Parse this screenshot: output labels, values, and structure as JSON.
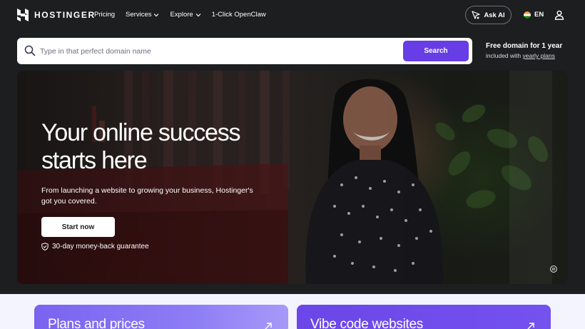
{
  "brand": {
    "name": "HOSTINGER",
    "accent": "#673de6"
  },
  "nav": {
    "items": [
      {
        "label": "Pricing",
        "dropdown": false
      },
      {
        "label": "Services",
        "dropdown": true
      },
      {
        "label": "Explore",
        "dropdown": true
      },
      {
        "label": "1-Click OpenClaw",
        "dropdown": false
      }
    ],
    "ask_ai": "Ask AI",
    "language": "EN"
  },
  "search": {
    "placeholder": "Type in that perfect domain name",
    "value": "",
    "button": "Search"
  },
  "promo": {
    "title": "Free domain for 1 year",
    "sub_prefix": "included with ",
    "sub_link": "yearly plans"
  },
  "hero": {
    "title_line1": "Your online success",
    "title_line2": "starts here",
    "subtitle": "From launching a website to growing your business, Hostinger's got you covered.",
    "cta": "Start now",
    "guarantee": "30-day money-back guarantee"
  },
  "cards": [
    {
      "title": "Plans and prices"
    },
    {
      "title": "Vibe code websites"
    }
  ],
  "icons": {
    "logo": "hostinger-logo-icon",
    "search": "search-icon",
    "ai": "sparkle-icon",
    "flag": "india-flag-icon",
    "user": "user-icon",
    "shield": "shield-check-icon",
    "pause": "pause-icon",
    "arrow": "arrow-up-right-icon"
  }
}
